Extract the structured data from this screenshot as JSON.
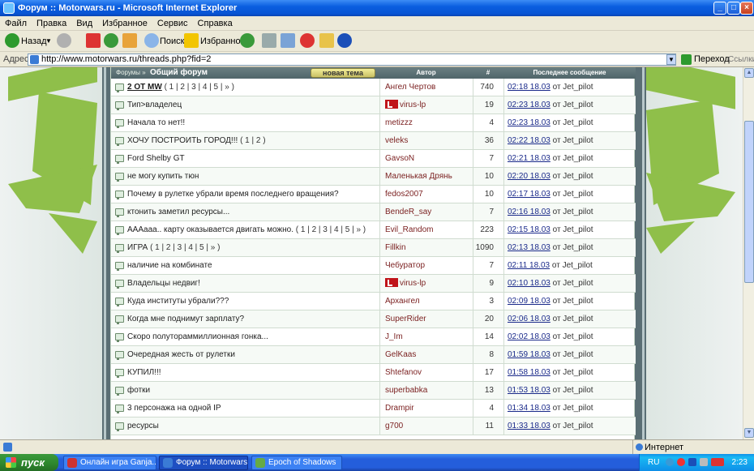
{
  "window": {
    "title": "Форум :: Motorwars.ru - Microsoft Internet Explorer"
  },
  "menu": [
    "Файл",
    "Правка",
    "Вид",
    "Избранное",
    "Сервис",
    "Справка"
  ],
  "toolbar": {
    "back": "Назад",
    "search": "Поиск",
    "favorites": "Избранное"
  },
  "address": {
    "label": "Адрес:",
    "url": "http://www.motorwars.ru/threads.php?fid=2",
    "go": "Переход",
    "links": "Ссылки"
  },
  "forum": {
    "breadcrumb": "Форумы »",
    "name": "Общий форум",
    "new_topic": "новая тема",
    "columns": {
      "author": "Автор",
      "count": "#",
      "last": "Последнее сообщение"
    },
    "rows": [
      {
        "title": "2 ОТ MW",
        "pages": "( 1 | 2 | 3 | 4 | 5 | » )",
        "author": "Ангел Чертов",
        "count": "740",
        "date": "02:18 18.03",
        "by": "от Jet_pilot",
        "bold": true
      },
      {
        "title": "Тип>владелец",
        "pages": "",
        "author": "virus-lp",
        "count": "19",
        "date": "02:23 18.03",
        "by": "от Jet_pilot",
        "badge": true
      },
      {
        "title": "Начала то нет!!",
        "pages": "",
        "author": "metizzz",
        "count": "4",
        "date": "02:23 18.03",
        "by": "от Jet_pilot"
      },
      {
        "title": "ХОЧУ ПОСТРОИТЬ ГОРОД!!!",
        "pages": "( 1 | 2 )",
        "author": "veleks",
        "count": "36",
        "date": "02:22 18.03",
        "by": "от Jet_pilot"
      },
      {
        "title": "Ford Shelby GT",
        "pages": "",
        "author": "GavsoN",
        "count": "7",
        "date": "02:21 18.03",
        "by": "от Jet_pilot"
      },
      {
        "title": "не могу купить тюн",
        "pages": "",
        "author": "Маленькая Дрянь",
        "count": "10",
        "date": "02:20 18.03",
        "by": "от Jet_pilot"
      },
      {
        "title": "Почему в рулетке убрали время последнего вращения?",
        "pages": "",
        "author": "fedos2007",
        "count": "10",
        "date": "02:17 18.03",
        "by": "от Jet_pilot"
      },
      {
        "title": "ктонить заметил ресурсы...",
        "pages": "",
        "author": "BendeR_say",
        "count": "7",
        "date": "02:16 18.03",
        "by": "от Jet_pilot"
      },
      {
        "title": "AAAaaa.. карту оказывается двигать можно.",
        "pages": "( 1 | 2 | 3 | 4 | 5 | » )",
        "author": "Evil_Random",
        "count": "223",
        "date": "02:15 18.03",
        "by": "от Jet_pilot"
      },
      {
        "title": "ИГРА",
        "pages": "( 1 | 2 | 3 | 4 | 5 | » )",
        "author": "Fillkin",
        "count": "1090",
        "date": "02:13 18.03",
        "by": "от Jet_pilot"
      },
      {
        "title": "наличие на комбинате",
        "pages": "",
        "author": "Чебуратор",
        "count": "7",
        "date": "02:11 18.03",
        "by": "от Jet_pilot"
      },
      {
        "title": "Владельцы недвиг!",
        "pages": "",
        "author": "virus-lp",
        "count": "9",
        "date": "02:10 18.03",
        "by": "от Jet_pilot",
        "badge": true
      },
      {
        "title": "Куда институты убрали???",
        "pages": "",
        "author": "Архангел",
        "count": "3",
        "date": "02:09 18.03",
        "by": "от Jet_pilot"
      },
      {
        "title": "Когда мне поднимут зарплату?",
        "pages": "",
        "author": "SuperRider",
        "count": "20",
        "date": "02:06 18.03",
        "by": "от Jet_pilot"
      },
      {
        "title": "Скоро полутораммиллионная гонка...",
        "pages": "",
        "author": "J_Im",
        "count": "14",
        "date": "02:02 18.03",
        "by": "от Jet_pilot"
      },
      {
        "title": "Очередная жесть от рулетки",
        "pages": "",
        "author": "GelKaas",
        "count": "8",
        "date": "01:59 18.03",
        "by": "от Jet_pilot"
      },
      {
        "title": "КУПИЛ!!!",
        "pages": "",
        "author": "Shtefanov",
        "count": "17",
        "date": "01:58 18.03",
        "by": "от Jet_pilot"
      },
      {
        "title": "фотки",
        "pages": "",
        "author": "superbabka",
        "count": "13",
        "date": "01:53 18.03",
        "by": "от Jet_pilot"
      },
      {
        "title": "3 персонажа на одной IP",
        "pages": "",
        "author": "Drampir",
        "count": "4",
        "date": "01:34 18.03",
        "by": "от Jet_pilot"
      },
      {
        "title": "ресурсы",
        "pages": "",
        "author": "g700",
        "count": "11",
        "date": "01:33 18.03",
        "by": "от Jet_pilot"
      }
    ]
  },
  "status": {
    "zone": "Интернет"
  },
  "taskbar": {
    "start": "пуск",
    "tasks": [
      "Онлайн игра Ganja...",
      "Форум :: Motorwars....",
      "Epoch of Shadows"
    ],
    "lang": "RU",
    "clock": "2:23"
  },
  "colors": {
    "header": "#55696e",
    "link": "#1a2a8a",
    "author": "#7a1f1f",
    "accent_green": "#8fbf4a"
  }
}
